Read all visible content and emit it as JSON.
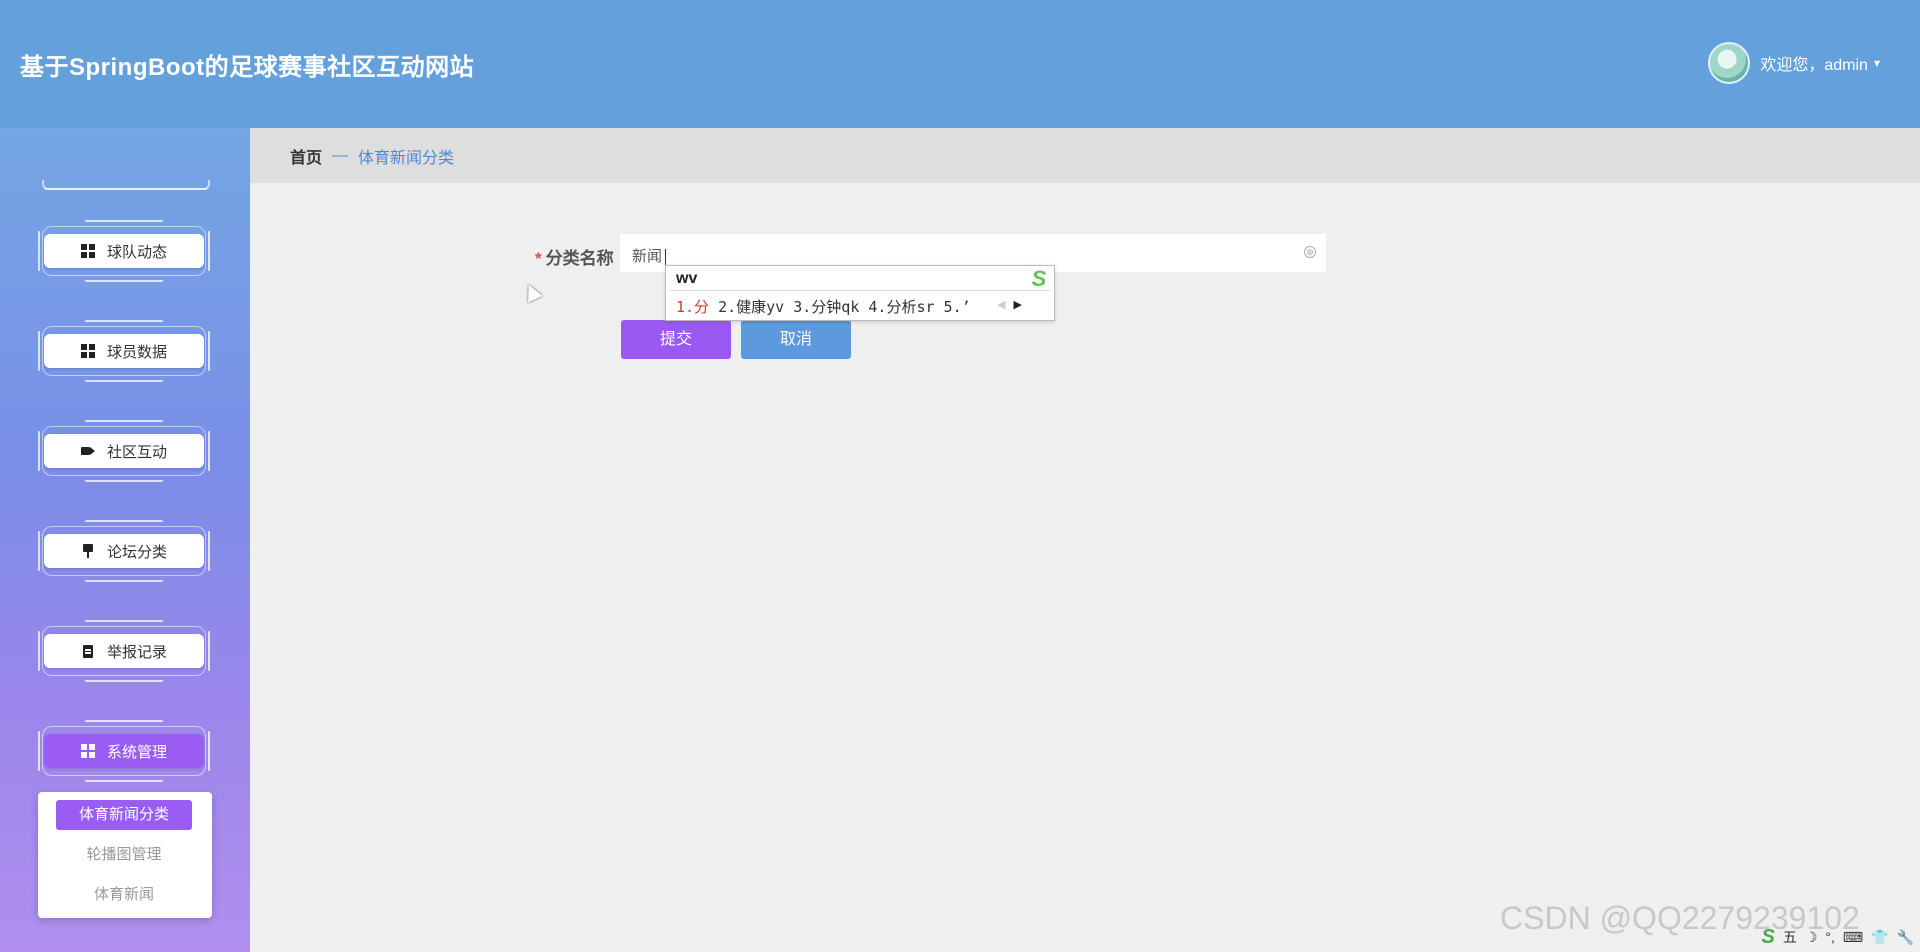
{
  "header": {
    "title": "基于SpringBoot的足球赛事社区互动网站",
    "welcome": "欢迎您，admin",
    "caret": "▾"
  },
  "sidebar": {
    "items": [
      {
        "label": "球队动态",
        "icon": "grid-icon"
      },
      {
        "label": "球员数据",
        "icon": "grid-icon"
      },
      {
        "label": "社区互动",
        "icon": "video-icon"
      },
      {
        "label": "论坛分类",
        "icon": "flag-icon"
      },
      {
        "label": "举报记录",
        "icon": "clipboard-icon"
      },
      {
        "label": "系统管理",
        "icon": "grid-icon",
        "active": true
      }
    ],
    "submenu": [
      {
        "label": "体育新闻分类",
        "active": true
      },
      {
        "label": "轮播图管理"
      },
      {
        "label": "体育新闻"
      }
    ]
  },
  "breadcrumb": {
    "home": "首页",
    "separator": "—",
    "current": "体育新闻分类"
  },
  "form": {
    "required_mark": "*",
    "label": "分类名称",
    "value": "新闻",
    "clear_icon": "⊗",
    "submit": "提交",
    "cancel": "取消"
  },
  "ime": {
    "composition": "wv",
    "candidate_first": "1.分",
    "candidates_rest": "  2.健康yv  3.分钟qk  4.分析sr  5.’",
    "logo": "S"
  },
  "watermark": "CSDN @QQ2279239102",
  "tray": {
    "items": [
      "S",
      "五",
      "☽",
      "°,",
      "⌨",
      "👕",
      "🔧"
    ]
  },
  "colors": {
    "header": "#63a0dc",
    "accent_purple": "#9b59f3",
    "accent_blue": "#5d99dd",
    "required": "#e34a4a"
  }
}
